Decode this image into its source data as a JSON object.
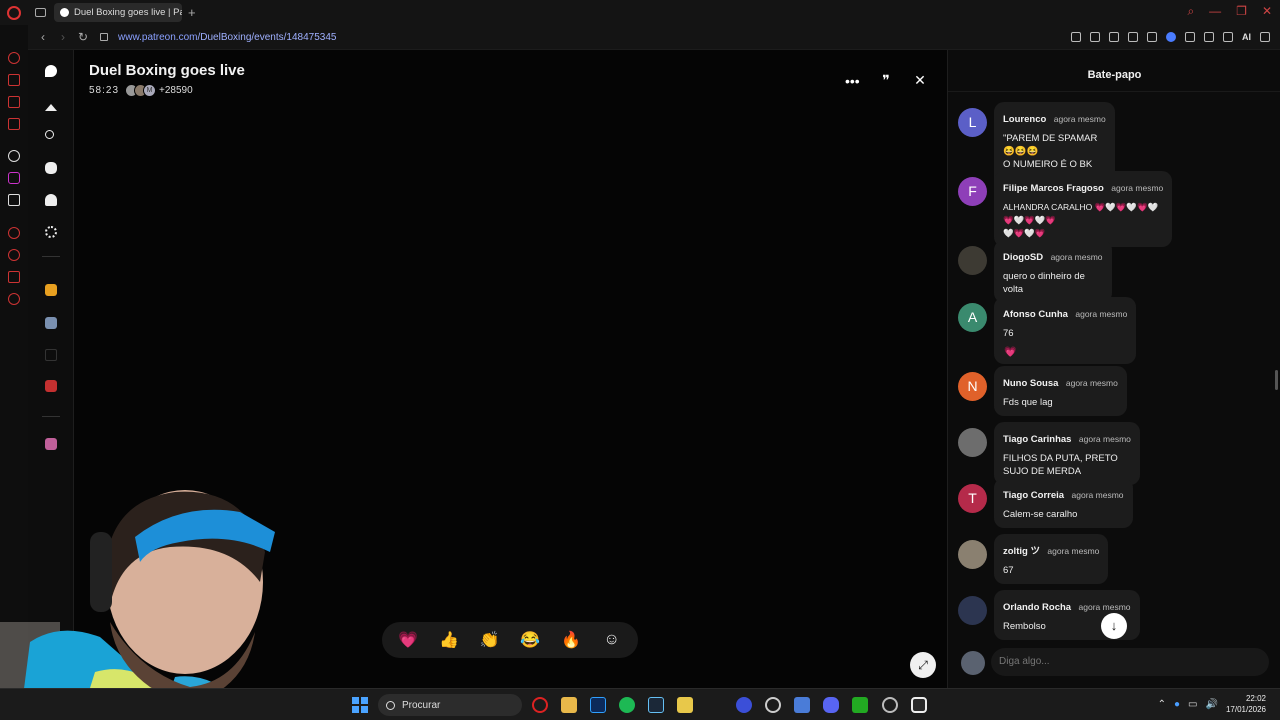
{
  "browser": {
    "tab_title": "Duel Boxing goes live | Pat",
    "url_prefix": "www.patreon.com",
    "url_path": "/DuelBoxing/events/148475345",
    "ai_label": "AI"
  },
  "stream": {
    "title": "Duel Boxing goes live",
    "timer": "58:23",
    "avatar_initial": "M",
    "viewers": "+28590"
  },
  "reactions": [
    "💗",
    "👍",
    "👏",
    "😂",
    "🔥",
    "☺"
  ],
  "chat": {
    "header": "Bate-papo",
    "input_placeholder": "Diga algo...",
    "messages": [
      {
        "name": "Lourenco",
        "time": "agora mesmo",
        "text": "\"PAREM DE SPAMAR 😆😆😆\nO NUMEIRO É O BK KING\"",
        "initial": "L",
        "color": "#5b5fc7"
      },
      {
        "name": "Filipe Marcos Fragoso",
        "time": "agora mesmo",
        "text": "ALHANDRA CARALHO 💗🤍💗🤍💗🤍💗🤍💗🤍💗\n🤍💗🤍💗",
        "initial": "F",
        "color": "#8e3fb8"
      },
      {
        "name": "DiogoSD",
        "time": "agora mesmo",
        "text": "quero o dinheiro de volta",
        "initial": "",
        "color": "#3d3a33"
      },
      {
        "name": "Afonso Cunha",
        "time": "agora mesmo",
        "text": "76",
        "initial": "A",
        "color": "#3a8a6e",
        "reaction": "💗"
      },
      {
        "name": "Nuno Sousa",
        "time": "agora mesmo",
        "text": "Fds que lag",
        "initial": "N",
        "color": "#e0612a"
      },
      {
        "name": "Tiago Carinhas",
        "time": "agora mesmo",
        "text": "FILHOS DA PUTA, PRETO SUJO DE MERDA",
        "initial": "",
        "color": "#6d6d6d"
      },
      {
        "name": "Tiago Correia",
        "time": "agora mesmo",
        "text": "Calem-se caralho",
        "initial": "T",
        "color": "#b52a4a"
      },
      {
        "name": "zoltig ツ",
        "time": "agora mesmo",
        "text": "67",
        "initial": "",
        "color": "#8a8070"
      },
      {
        "name": "Orlando Rocha",
        "time": "agora mesmo",
        "text": "Rembolso",
        "initial": "",
        "color": "#2c3550"
      }
    ]
  },
  "taskbar": {
    "search_label": "Procurar",
    "time": "22:02",
    "date": "17/01/2026"
  }
}
